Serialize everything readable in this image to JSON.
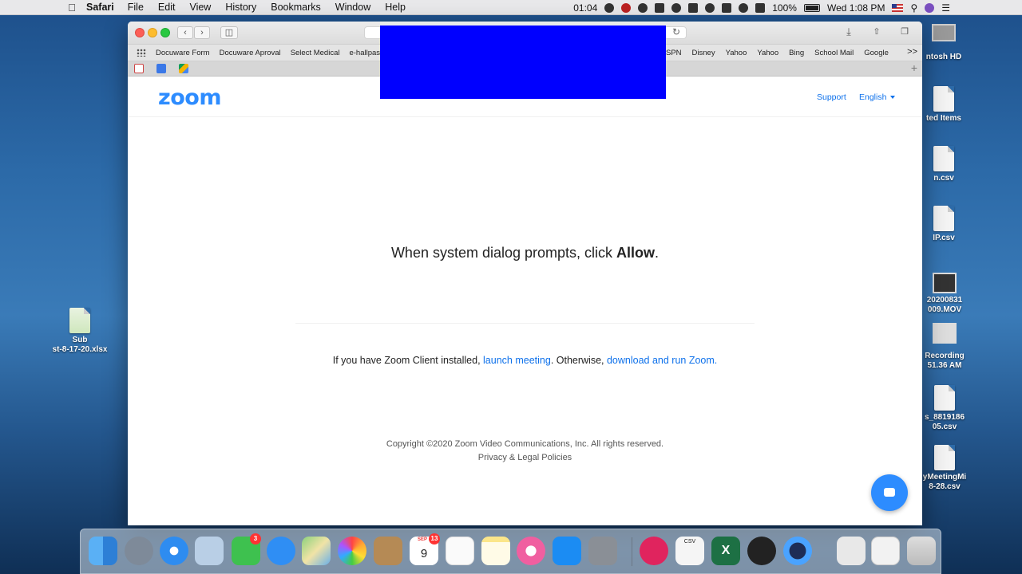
{
  "menubar": {
    "app": "Safari",
    "items": [
      "File",
      "Edit",
      "View",
      "History",
      "Bookmarks",
      "Window",
      "Help"
    ],
    "timer": "01:04",
    "battery": "100%",
    "clock": "Wed 1:08 PM"
  },
  "desktop": {
    "left_file": {
      "line1": "Sub",
      "line2": "st-8-17-20.xlsx"
    },
    "right_items": [
      "ntosh HD",
      "ted Items",
      "n.csv",
      "IP.csv",
      "20200831 009.MOV",
      "Recording 51.36 AM",
      "s_8819186 05.csv",
      "yMeetingMi 8-28.csv"
    ]
  },
  "bookmarks": {
    "left": [
      "Docuware Form",
      "Docuware Aproval",
      "Select Medical",
      "e-hallpass"
    ],
    "right": [
      "SPN",
      "Disney",
      "Yahoo",
      "Yahoo",
      "Bing",
      "School Mail",
      "Google"
    ],
    "more": ">>"
  },
  "page": {
    "logo": "zoom",
    "support": "Support",
    "language": "English",
    "prompt_prefix": "When system dialog prompts, click ",
    "prompt_bold": "Allow",
    "prompt_suffix": ".",
    "client_prefix": "If you have Zoom Client installed, ",
    "launch_link": "launch meeting",
    "client_middle": ". Otherwise, ",
    "download_link": "download and run Zoom.",
    "copyright": "Copyright ©2020 Zoom Video Communications, Inc. All rights reserved.",
    "privacy": "Privacy & Legal Policies"
  },
  "dock": {
    "facetime_badge": "3",
    "calendar_month": "SEP",
    "calendar_day": "9",
    "calendar_badge": "13",
    "csv_label": "CSV"
  },
  "colors": {
    "zoom_blue": "#2d8cff",
    "link_blue": "#0e71eb",
    "redaction": "#0000ff"
  }
}
